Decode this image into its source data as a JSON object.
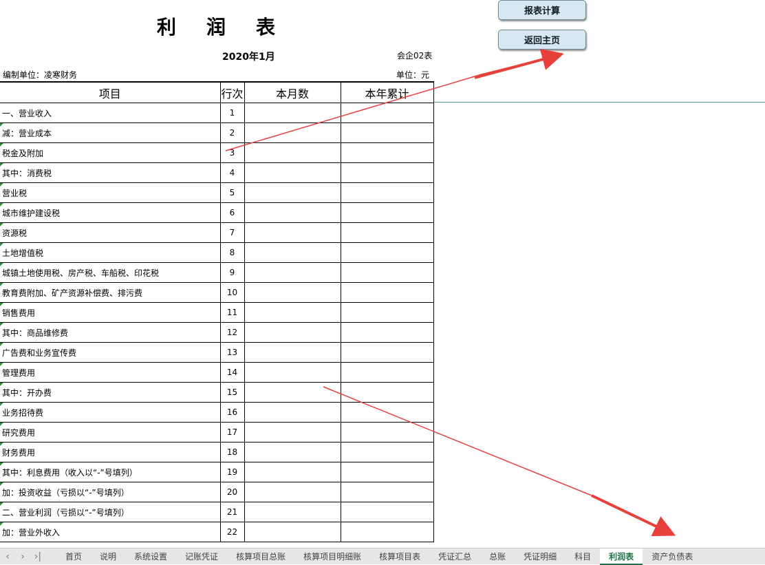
{
  "header": {
    "title_chars": [
      "利",
      "润",
      "表"
    ],
    "period": "2020年1月",
    "form_no": "会企02表",
    "company": "编制单位：凌寒财务",
    "unit": "单位：元"
  },
  "buttons": {
    "calc_label": "报表计算",
    "home_label": "返回主页"
  },
  "table": {
    "headers": [
      "项目",
      "行次",
      "本月数",
      "本年累计"
    ],
    "rows": [
      {
        "item": "一、营业收入",
        "no": "1",
        "month": "",
        "ytd": ""
      },
      {
        "item": "减：营业成本",
        "no": "2",
        "month": "",
        "ytd": ""
      },
      {
        "item": "税金及附加",
        "no": "3",
        "month": "",
        "ytd": ""
      },
      {
        "item": "其中：消费税",
        "no": "4",
        "month": "",
        "ytd": ""
      },
      {
        "item": "营业税",
        "no": "5",
        "month": "",
        "ytd": ""
      },
      {
        "item": "城市维护建设税",
        "no": "6",
        "month": "",
        "ytd": ""
      },
      {
        "item": "资源税",
        "no": "7",
        "month": "",
        "ytd": ""
      },
      {
        "item": "土地增值税",
        "no": "8",
        "month": "",
        "ytd": ""
      },
      {
        "item": "城镇土地使用税、房产税、车船税、印花税",
        "no": "9",
        "month": "",
        "ytd": ""
      },
      {
        "item": "教育费附加、矿产资源补偿费、排污费",
        "no": "10",
        "month": "",
        "ytd": ""
      },
      {
        "item": "销售费用",
        "no": "11",
        "month": "",
        "ytd": ""
      },
      {
        "item": "其中：商品维修费",
        "no": "12",
        "month": "",
        "ytd": ""
      },
      {
        "item": "广告费和业务宣传费",
        "no": "13",
        "month": "",
        "ytd": ""
      },
      {
        "item": "管理费用",
        "no": "14",
        "month": "",
        "ytd": ""
      },
      {
        "item": "其中：开办费",
        "no": "15",
        "month": "",
        "ytd": ""
      },
      {
        "item": "业务招待费",
        "no": "16",
        "month": "",
        "ytd": ""
      },
      {
        "item": "研究费用",
        "no": "17",
        "month": "",
        "ytd": ""
      },
      {
        "item": "财务费用",
        "no": "18",
        "month": "",
        "ytd": ""
      },
      {
        "item": "其中：利息费用（收入以“-”号填列）",
        "no": "19",
        "month": "",
        "ytd": ""
      },
      {
        "item": "加：投资收益（亏损以“-”号填列）",
        "no": "20",
        "month": "",
        "ytd": ""
      },
      {
        "item": "二、营业利润（亏损以“-”号填列）",
        "no": "21",
        "month": "",
        "ytd": ""
      },
      {
        "item": "加：营业外收入",
        "no": "22",
        "month": "",
        "ytd": ""
      }
    ]
  },
  "sheet_nav": {
    "first_icon": "chevron-left-icon",
    "next_icon": "chevron-right-icon",
    "last_icon": "chevron-last-icon",
    "first_glyph": "‹",
    "next_glyph": "›",
    "last_glyph": "›|"
  },
  "sheet_tabs": [
    {
      "label": "首页",
      "active": false
    },
    {
      "label": "说明",
      "active": false
    },
    {
      "label": "系统设置",
      "active": false
    },
    {
      "label": "记账凭证",
      "active": false
    },
    {
      "label": "核算项目总账",
      "active": false
    },
    {
      "label": "核算项目明细账",
      "active": false
    },
    {
      "label": "核算项目表",
      "active": false
    },
    {
      "label": "凭证汇总",
      "active": false
    },
    {
      "label": "总账",
      "active": false
    },
    {
      "label": "凭证明细",
      "active": false
    },
    {
      "label": "科目",
      "active": false
    },
    {
      "label": "利润表",
      "active": true
    },
    {
      "label": "资产负债表",
      "active": false
    }
  ],
  "colors": {
    "arrow": "#e8413c",
    "active_tab": "#217346",
    "button_bg": "#d7e8f0",
    "cell_marker": "#2e8b3e"
  }
}
